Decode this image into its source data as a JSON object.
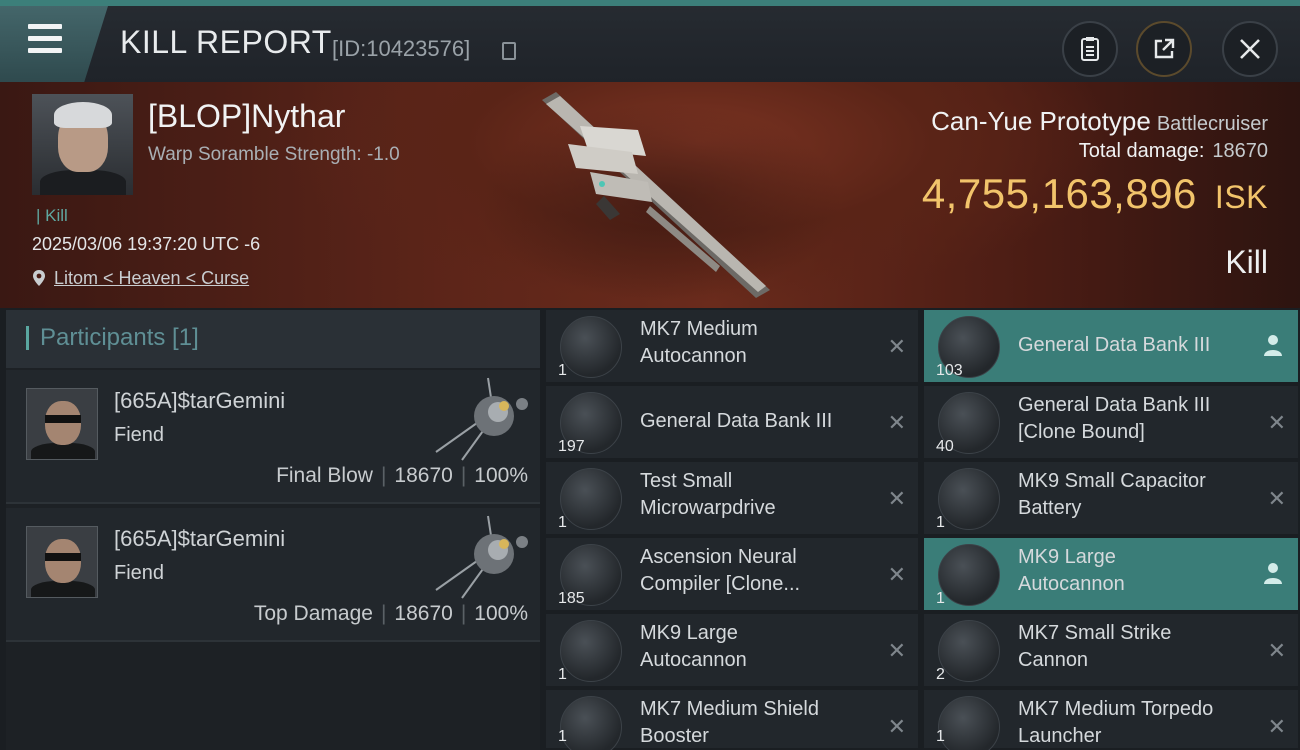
{
  "header": {
    "title": "KILL REPORT",
    "report_id": "[ID:10423576]"
  },
  "victim": {
    "name": "[BLOP]Nythar",
    "warp_scramble": "Warp Soramble Strength: -1.0",
    "kill_tag": "Kill",
    "datetime": "2025/03/06 19:37:20 UTC -6",
    "location": "Litom < Heaven < Curse",
    "ship_name": "Can-Yue Prototype",
    "ship_class": "Battlecruiser",
    "total_damage_label": "Total damage:",
    "total_damage": "18670",
    "isk_value": "4,755,163,896",
    "isk_unit": "ISK",
    "result": "Kill"
  },
  "participants": {
    "title": "Participants [1]",
    "rows": [
      {
        "name": "[665A]$tarGemini",
        "ship": "Fiend",
        "role": "Final Blow",
        "damage": "18670",
        "percent": "100%"
      },
      {
        "name": "[665A]$tarGemini",
        "ship": "Fiend",
        "role": "Top Damage",
        "damage": "18670",
        "percent": "100%"
      }
    ]
  },
  "items": {
    "left": [
      {
        "qty": "1",
        "l1": "MK7 Medium",
        "l2": "Autocannon"
      },
      {
        "qty": "197",
        "l1": "General Data Bank III",
        "l2": ""
      },
      {
        "qty": "1",
        "l1": "Test Small",
        "l2": "Microwarpdrive"
      },
      {
        "qty": "185",
        "l1": "Ascension Neural",
        "l2": "Compiler [Clone..."
      },
      {
        "qty": "1",
        "l1": "MK9 Large",
        "l2": "Autocannon"
      },
      {
        "qty": "1",
        "l1": "MK7 Medium Shield",
        "l2": "Booster"
      }
    ],
    "right": [
      {
        "qty": "103",
        "l1": "General Data Bank III",
        "l2": ""
      },
      {
        "qty": "40",
        "l1": "General Data Bank III",
        "l2": "[Clone Bound]"
      },
      {
        "qty": "1",
        "l1": "MK9 Small Capacitor",
        "l2": "Battery"
      },
      {
        "qty": "1",
        "l1": "MK9 Large",
        "l2": "Autocannon"
      },
      {
        "qty": "2",
        "l1": "MK7 Small Strike",
        "l2": "Cannon"
      },
      {
        "qty": "1",
        "l1": "MK7 Medium Torpedo",
        "l2": "Launcher"
      }
    ],
    "close_glyph": "✕"
  },
  "colors": {
    "accent": "#3a7d78",
    "isk": "#f2c46b"
  }
}
